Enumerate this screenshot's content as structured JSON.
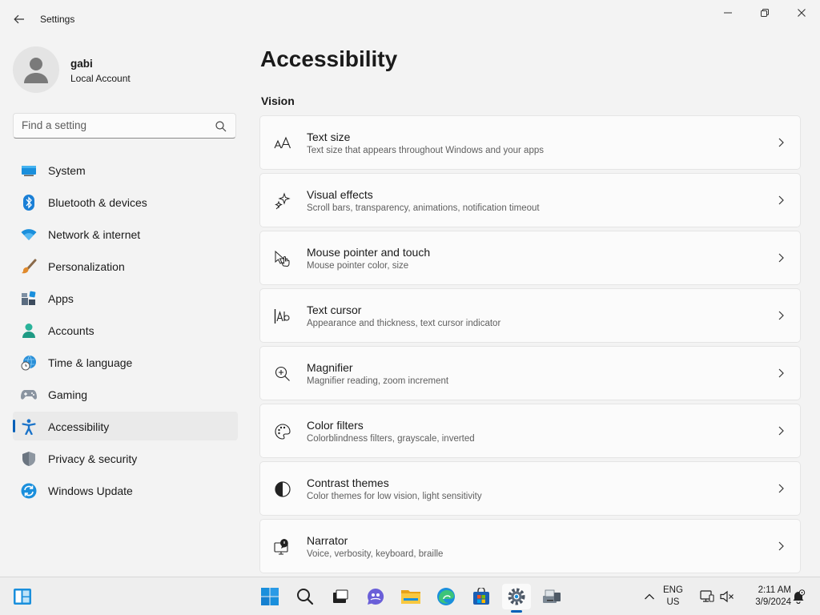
{
  "window": {
    "title": "Settings"
  },
  "user": {
    "name": "gabi",
    "account_type": "Local Account"
  },
  "search": {
    "placeholder": "Find a setting"
  },
  "sidebar": {
    "items": [
      {
        "label": "System",
        "icon": "monitor-icon"
      },
      {
        "label": "Bluetooth & devices",
        "icon": "bluetooth-icon"
      },
      {
        "label": "Network & internet",
        "icon": "wifi-icon"
      },
      {
        "label": "Personalization",
        "icon": "paintbrush-icon"
      },
      {
        "label": "Apps",
        "icon": "apps-icon"
      },
      {
        "label": "Accounts",
        "icon": "person-icon"
      },
      {
        "label": "Time & language",
        "icon": "globe-clock-icon"
      },
      {
        "label": "Gaming",
        "icon": "gamepad-icon"
      },
      {
        "label": "Accessibility",
        "icon": "accessibility-icon",
        "active": true
      },
      {
        "label": "Privacy & security",
        "icon": "shield-icon"
      },
      {
        "label": "Windows Update",
        "icon": "update-icon"
      }
    ]
  },
  "main": {
    "title": "Accessibility",
    "section": "Vision",
    "cards": [
      {
        "title": "Text size",
        "description": "Text size that appears throughout Windows and your apps",
        "icon": "text-size-icon"
      },
      {
        "title": "Visual effects",
        "description": "Scroll bars, transparency, animations, notification timeout",
        "icon": "sparkle-icon"
      },
      {
        "title": "Mouse pointer and touch",
        "description": "Mouse pointer color, size",
        "icon": "pointer-touch-icon"
      },
      {
        "title": "Text cursor",
        "description": "Appearance and thickness, text cursor indicator",
        "icon": "text-cursor-icon"
      },
      {
        "title": "Magnifier",
        "description": "Magnifier reading, zoom increment",
        "icon": "magnifier-icon"
      },
      {
        "title": "Color filters",
        "description": "Colorblindness filters, grayscale, inverted",
        "icon": "palette-icon"
      },
      {
        "title": "Contrast themes",
        "description": "Color themes for low vision, light sensitivity",
        "icon": "contrast-icon"
      },
      {
        "title": "Narrator",
        "description": "Voice, verbosity, keyboard, braille",
        "icon": "narrator-icon"
      }
    ]
  },
  "taskbar": {
    "language": {
      "line1": "ENG",
      "line2": "US"
    },
    "clock": {
      "time": "2:11 AM",
      "date": "3/9/2024"
    }
  },
  "colors": {
    "accent": "#005fb8",
    "background": "#f3f3f3",
    "card": "#fbfbfb"
  }
}
